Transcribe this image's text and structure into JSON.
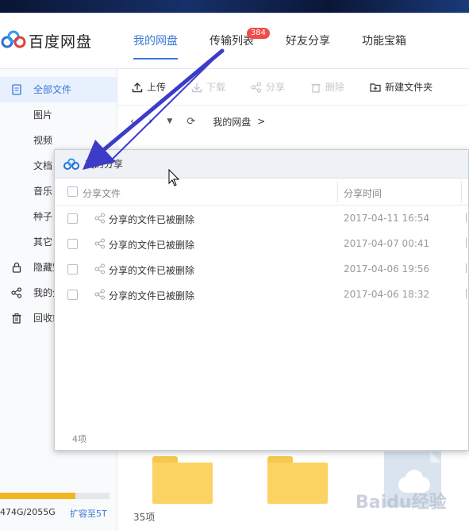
{
  "app": {
    "title": "百度网盘",
    "nav": [
      {
        "label": "我的网盘",
        "active": true
      },
      {
        "label": "传输列表",
        "badge": "384"
      },
      {
        "label": "好友分享"
      },
      {
        "label": "功能宝箱"
      }
    ]
  },
  "sidebar": {
    "items": [
      {
        "label": "全部文件",
        "icon": "document-icon",
        "active": true
      },
      {
        "label": "图片"
      },
      {
        "label": "视频"
      },
      {
        "label": "文档"
      },
      {
        "label": "音乐"
      },
      {
        "label": "种子"
      },
      {
        "label": "其它"
      },
      {
        "label": "隐藏空间",
        "icon": "lock-icon"
      },
      {
        "label": "我的分享",
        "icon": "share-icon"
      },
      {
        "label": "回收站",
        "icon": "trash-icon"
      }
    ],
    "quota": {
      "text": "474G/2055G",
      "expand": "扩容至5T",
      "fraction": 0.69
    }
  },
  "toolbar": {
    "upload": "上传",
    "download": "下载",
    "share": "分享",
    "delete": "删除",
    "new_folder": "新建文件夹"
  },
  "path": {
    "root": "我的网盘",
    "sep": ">"
  },
  "main": {
    "count": "35项",
    "watermark": "Baidu经验"
  },
  "dialog": {
    "title": "我的分享",
    "col_file": "分享文件",
    "col_time": "分享时间",
    "rows": [
      {
        "name": "分享的文件已被删除",
        "time": "2017-04-11 16:54"
      },
      {
        "name": "分享的文件已被删除",
        "time": "2017-04-07 00:41"
      },
      {
        "name": "分享的文件已被删除",
        "time": "2017-04-06 19:56"
      },
      {
        "name": "分享的文件已被删除",
        "time": "2017-04-06 18:32"
      }
    ],
    "count": "4项"
  },
  "colors": {
    "accent": "#3b78d8",
    "badge": "#f04c48",
    "quota": "#f3b61f",
    "arrow": "#3c3cc9"
  }
}
